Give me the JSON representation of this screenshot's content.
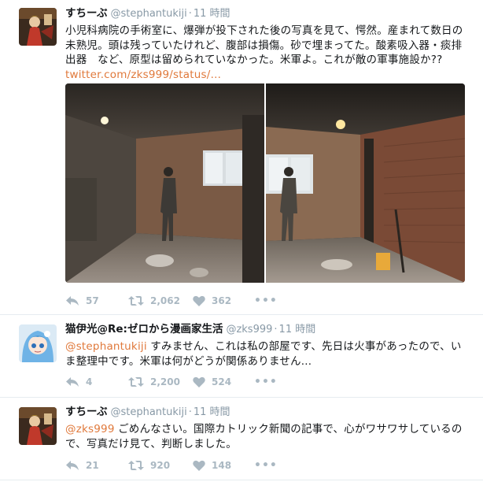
{
  "tweets": [
    {
      "fullname": "すちーぶ",
      "username": "@stephantukiji",
      "time": "11 時間",
      "text": "小児科病院の手術室に、爆弾が投下された後の写真を見て、愕然。産まれて数日の未熟児。頭は残っていたけれど、腹部は損傷。砂で埋まってた。酸素吸入器・痰排出器　など、原型は留められていなかった。米軍よ。これが敵の軍事施設か?? ",
      "link": "twitter.com/zks999/status/…",
      "replies": "57",
      "retweets": "2,062",
      "likes": "362",
      "more": "•••"
    },
    {
      "fullname": "猫伊光@Re:ゼロから漫画家生活",
      "username": "@zks999",
      "time": "11 時間",
      "mention": "@stephantukiji",
      "text": " すみません、これは私の部屋です、先日は火事があったので、いま整理中です。米軍は何がどうが関係ありません…",
      "replies": "4",
      "retweets": "2,200",
      "likes": "524",
      "more": "•••"
    },
    {
      "fullname": "すちーぶ",
      "username": "@stephantukiji",
      "time": "11 時間",
      "mention": "@zks999",
      "text": " ごめんなさい。国際カトリック新聞の記事で、心がワサワサしているので、写真だけ見て、判断しました。",
      "replies": "21",
      "retweets": "920",
      "likes": "148",
      "more": "•••"
    }
  ],
  "dot": "·",
  "colors": {
    "link": "#e0793b",
    "meta": "#8899a6",
    "action": "#aab8c2"
  }
}
